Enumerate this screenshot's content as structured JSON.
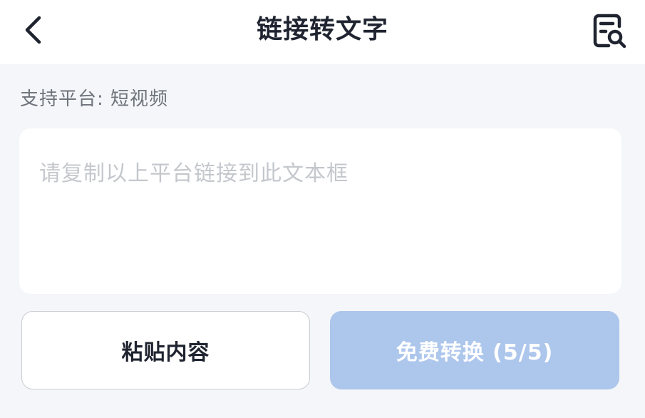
{
  "header": {
    "title": "链接转文字",
    "back_icon": "chevron-left-icon",
    "history_icon": "document-search-icon"
  },
  "platform": {
    "label": "支持平台: 短视频"
  },
  "input": {
    "value": "",
    "placeholder": "请复制以上平台链接到此文本框"
  },
  "actions": {
    "paste_label": "粘贴内容",
    "convert_label": "免费转换 (5/5)"
  },
  "colors": {
    "background": "#f4f6f9",
    "convert_button": "#adc6ec",
    "title_text": "#1f2430"
  }
}
